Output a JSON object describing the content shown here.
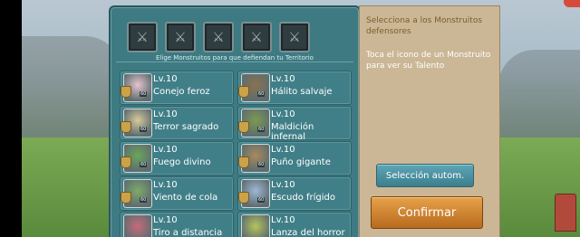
{
  "slots": 5,
  "hint": "Elige Monstruitos para que defiendan tu Territorio",
  "monsters": [
    {
      "level": "Lv.10",
      "name": "Conejo feroz",
      "badge": "60",
      "color": "#e7c3cf"
    },
    {
      "level": "Lv.10",
      "name": "Hálito salvaje",
      "badge": "60",
      "color": "#8b7250"
    },
    {
      "level": "Lv.10",
      "name": "Terror sagrado",
      "badge": "60",
      "color": "#d8c99a"
    },
    {
      "level": "Lv.10",
      "name": "Maldición infernal",
      "badge": "60",
      "color": "#7d9a4e"
    },
    {
      "level": "Lv.10",
      "name": "Fuego divino",
      "badge": "60",
      "color": "#6aa65a"
    },
    {
      "level": "Lv.10",
      "name": "Puño gigante",
      "badge": "60",
      "color": "#a98a5c"
    },
    {
      "level": "Lv.10",
      "name": "Viento de cola",
      "badge": "60",
      "color": "#7faa6a"
    },
    {
      "level": "Lv.10",
      "name": "Escudo frígido",
      "badge": "60",
      "color": "#9fb7d6"
    },
    {
      "level": "Lv.10",
      "name": "Tiro a distancia",
      "badge": "",
      "color": "#c86a7a"
    },
    {
      "level": "Lv.10",
      "name": "Lanza del horror",
      "badge": "",
      "color": "#b7c45a"
    }
  ],
  "side": {
    "title": "Selecciona a los Monstruitos defensores",
    "body": "Toca el icono de un Monstruito para ver su Talento",
    "auto_label": "Selección autom.",
    "confirm_label": "Confirmar"
  }
}
